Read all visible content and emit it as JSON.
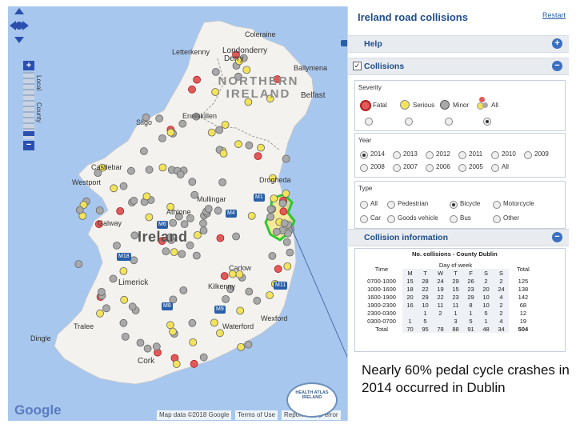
{
  "app": {
    "title": "Ireland road collisions",
    "restart": "Restart"
  },
  "sections": {
    "help": "Help",
    "collisions": "Collisions",
    "collision_info": "Collision information"
  },
  "severity": {
    "header": "Severity",
    "options": [
      "Fatal",
      "Serious",
      "Minor",
      "All"
    ],
    "selected": "All"
  },
  "year": {
    "header": "Year",
    "row1": [
      "2014",
      "2013",
      "2012",
      "2011",
      "2010",
      "2009"
    ],
    "row2": [
      "2008",
      "2007",
      "2006",
      "2005",
      "All"
    ],
    "selected": "2014"
  },
  "type": {
    "header": "Type",
    "row1": [
      "All",
      "Pedestrian",
      "Bicycle",
      "Motorcycle"
    ],
    "row2": [
      "Car",
      "Goods vehicle",
      "Bus",
      "Other"
    ],
    "selected": "Bicycle"
  },
  "table": {
    "title": "No. collisions - County Dublin",
    "time_header": "Time",
    "dow_header": "Day of week",
    "days": [
      "M",
      "T",
      "W",
      "T",
      "F",
      "S",
      "S"
    ],
    "total_header": "Total",
    "rows": [
      {
        "time": "0700-1000",
        "vals": [
          "15",
          "28",
          "24",
          "29",
          "26",
          "2",
          "2"
        ],
        "total": "125"
      },
      {
        "time": "1000-1600",
        "vals": [
          "18",
          "22",
          "19",
          "15",
          "23",
          "20",
          "24"
        ],
        "total": "138"
      },
      {
        "time": "1600-1900",
        "vals": [
          "20",
          "29",
          "22",
          "23",
          "29",
          "10",
          "4"
        ],
        "total": "142"
      },
      {
        "time": "1900-2300",
        "vals": [
          "16",
          "10",
          "11",
          "11",
          "8",
          "10",
          "2"
        ],
        "total": "68"
      },
      {
        "time": "2300-0300",
        "vals": [
          "",
          "1",
          "2",
          "1",
          "1",
          "5",
          "2"
        ],
        "total": "12"
      },
      {
        "time": "0300-0700",
        "vals": [
          "1",
          "5",
          "",
          "3",
          "5",
          "1",
          "4"
        ],
        "total": "19"
      },
      {
        "time": "Total",
        "vals": [
          "70",
          "95",
          "78",
          "88",
          "91",
          "48",
          "34"
        ],
        "total": "504"
      }
    ]
  },
  "map": {
    "country_ni": "NORTHERN IRELAND",
    "country_ie": "Ireland",
    "places": [
      {
        "id": "coleraine",
        "name": "Coleraine"
      },
      {
        "id": "letterkenny",
        "name": "Letterkenny"
      },
      {
        "id": "londonderry",
        "name": "Londonderry"
      },
      {
        "id": "derry",
        "name": "Derry"
      },
      {
        "id": "ballymena",
        "name": "Ballymena"
      },
      {
        "id": "belfast",
        "name": "Belfast"
      },
      {
        "id": "enniskillen",
        "name": "Enniskillen"
      },
      {
        "id": "sligo",
        "name": "Sligo"
      },
      {
        "id": "drogheda",
        "name": "Drogheda"
      },
      {
        "id": "westport",
        "name": "Westport"
      },
      {
        "id": "mullingar",
        "name": "Mullingar"
      },
      {
        "id": "athlone",
        "name": "Athlone"
      },
      {
        "id": "galway",
        "name": "Galway"
      },
      {
        "id": "limerick",
        "name": "Limerick"
      },
      {
        "id": "kilkenny",
        "name": "Kilkenny"
      },
      {
        "id": "carlow",
        "name": "Carlow"
      },
      {
        "id": "tralee",
        "name": "Tralee"
      },
      {
        "id": "wexford",
        "name": "Wexford"
      },
      {
        "id": "waterford",
        "name": "Waterford"
      },
      {
        "id": "cork",
        "name": "Cork"
      },
      {
        "id": "dingle",
        "name": "Dingle"
      },
      {
        "id": "castlebar",
        "name": "Castlebar"
      }
    ],
    "roads": [
      "M1",
      "M4",
      "M6",
      "M18",
      "M11",
      "M9",
      "M8"
    ],
    "zoom_labels": [
      "Local",
      "County"
    ],
    "google": "Google",
    "attrib1": "Map data ©2018 Google",
    "attrib2": "Terms of Use",
    "attrib3": "Report a map error",
    "logo_text": "HEALTH ATLAS IRELAND"
  },
  "annotation": "Nearly 60% pedal cycle crashes in 2014 occurred in Dublin",
  "colors": {
    "fatal": "#e05a5a",
    "serious": "#f3e35a",
    "minor": "#a9a9a9",
    "sea": "#a8c7ee",
    "land": "#f3f2ee",
    "dublin_outline": "#2fc82f",
    "accent": "#1f4e8c"
  }
}
